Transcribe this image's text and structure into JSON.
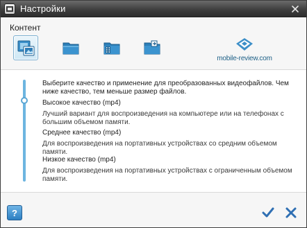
{
  "window": {
    "title": "Настройки"
  },
  "section": {
    "title": "Контент"
  },
  "toolbar": {
    "tools": [
      {
        "icon": "image-convert-icon",
        "selected": true
      },
      {
        "icon": "folder-icon",
        "selected": false
      },
      {
        "icon": "media-folder-icon",
        "selected": false
      },
      {
        "icon": "folder-export-icon",
        "selected": false
      }
    ]
  },
  "logo": {
    "text": "mobile-review.com"
  },
  "content": {
    "intro": "Выберите качество и применение для преобразованных видеофайлов. Чем ниже качество, тем меньше размер файлов.",
    "options": [
      {
        "title": "Высокое качество (mp4)",
        "description": "Лучший вариант для воспроизведения на компьютере или на телефонах с большим объемом памяти."
      },
      {
        "title": "Среднее качество (mp4)",
        "description": "Для воспроизведения на портативных устройствах со средним объемом памяти."
      },
      {
        "title": "Низкое качество (mp4)",
        "description": "Для воспроизведения на портативных устройствах с ограниченным объемом памяти."
      }
    ],
    "selected_option": "Высокое качество (mp4)"
  },
  "buttons": {
    "help_label": "?"
  },
  "colors": {
    "titlebar": "#3f3f3f",
    "accent": "#2c7fc2",
    "slider": "#6db5e0",
    "ok": "#2f6fb3",
    "cancel": "#2f6fb3"
  }
}
